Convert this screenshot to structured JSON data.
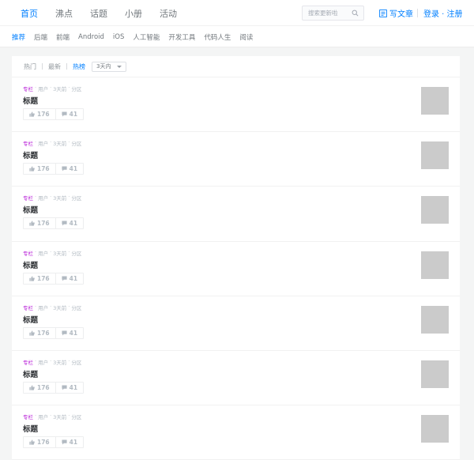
{
  "nav": {
    "items": [
      "首页",
      "沸点",
      "话题",
      "小册",
      "活动"
    ],
    "active_index": 0
  },
  "search": {
    "placeholder": "搜索更新啦"
  },
  "header": {
    "write_label": "写文章",
    "auth_label": "登录 · 注册"
  },
  "subnav": {
    "items": [
      "推荐",
      "后端",
      "前端",
      "Android",
      "iOS",
      "人工智能",
      "开发工具",
      "代码人生",
      "阅读"
    ],
    "active_index": 0
  },
  "feed": {
    "tabs": [
      "热门",
      "最新",
      "热榜"
    ],
    "active_tab_index": 2,
    "range_select": "3天内",
    "entries": [
      {
        "tag": "专栏",
        "user": "用户",
        "time": "3天前",
        "category": "分区",
        "title": "标题",
        "likes": "176",
        "comments": "41"
      },
      {
        "tag": "专栏",
        "user": "用户",
        "time": "3天前",
        "category": "分区",
        "title": "标题",
        "likes": "176",
        "comments": "41"
      },
      {
        "tag": "专栏",
        "user": "用户",
        "time": "3天前",
        "category": "分区",
        "title": "标题",
        "likes": "176",
        "comments": "41"
      },
      {
        "tag": "专栏",
        "user": "用户",
        "time": "3天前",
        "category": "分区",
        "title": "标题",
        "likes": "176",
        "comments": "41"
      },
      {
        "tag": "专栏",
        "user": "用户",
        "time": "3天前",
        "category": "分区",
        "title": "标题",
        "likes": "176",
        "comments": "41"
      },
      {
        "tag": "专栏",
        "user": "用户",
        "time": "3天前",
        "category": "分区",
        "title": "标题",
        "likes": "176",
        "comments": "41"
      },
      {
        "tag": "专栏",
        "user": "用户",
        "time": "3天前",
        "category": "分区",
        "title": "标题",
        "likes": "176",
        "comments": "41"
      }
    ]
  },
  "colors": {
    "accent": "#007fff",
    "tag": "#b71ed7",
    "muted": "#b2bac2",
    "thumb": "#cbcbcb"
  },
  "icons": [
    "search-icon",
    "edit-icon",
    "thumbs-up-icon",
    "comment-icon",
    "chevron-down-icon"
  ]
}
